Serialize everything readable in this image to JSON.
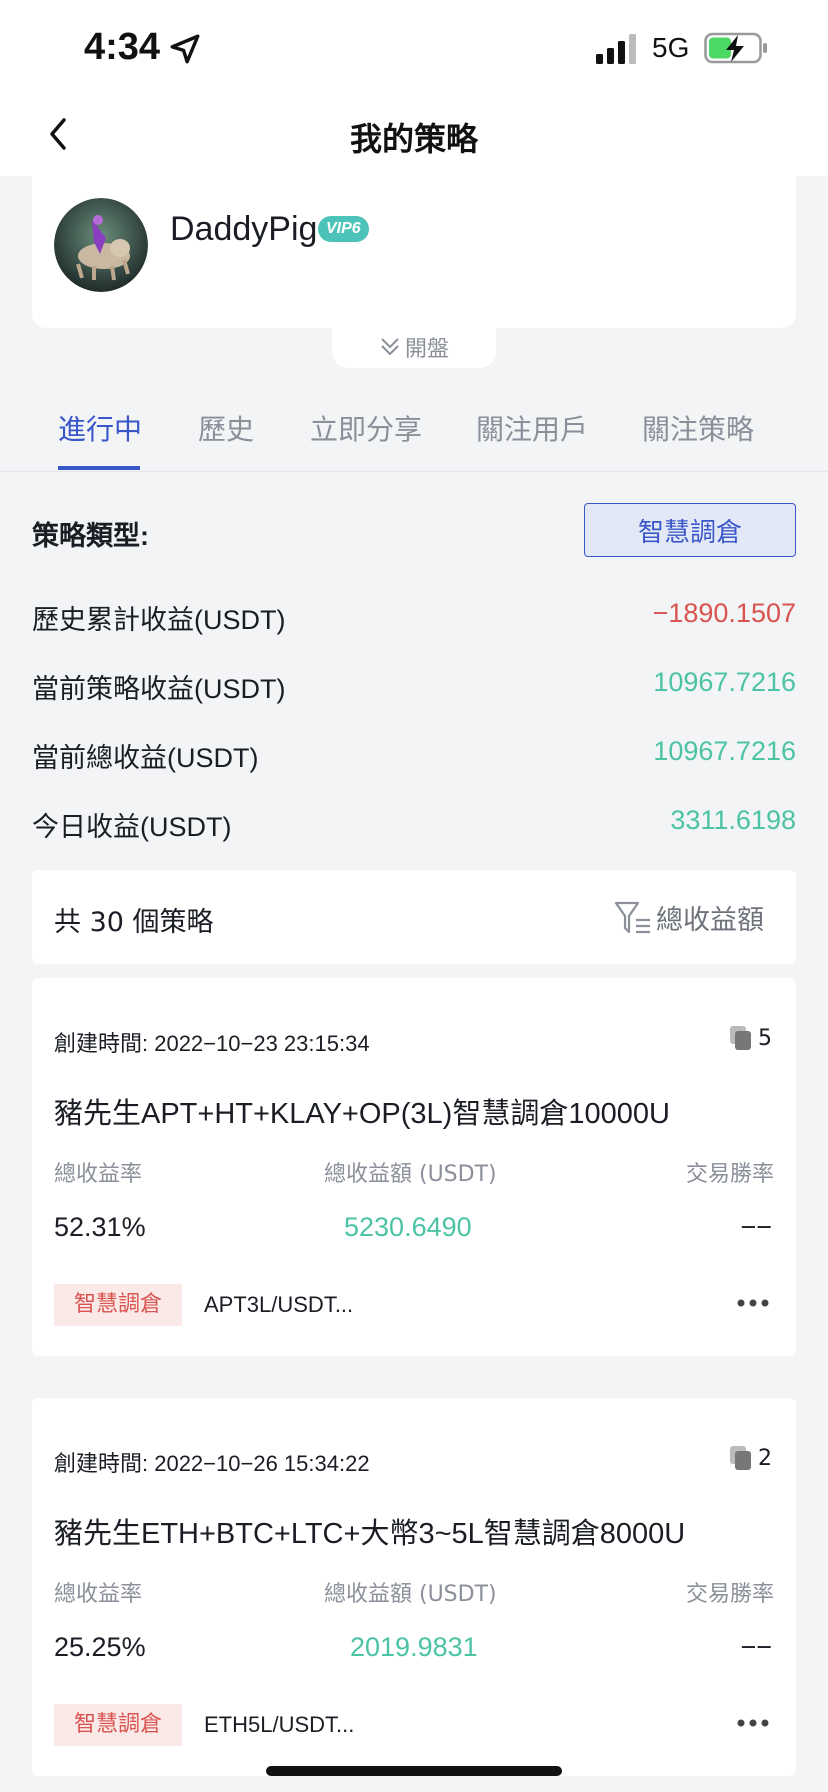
{
  "status": {
    "time": "4:34",
    "network": "5G"
  },
  "nav": {
    "title": "我的策略"
  },
  "profile": {
    "username": "DaddyPig",
    "vip": "VIP6",
    "expand_label": "開盤"
  },
  "tabs": [
    {
      "label": "進行中",
      "active": true
    },
    {
      "label": "歷史"
    },
    {
      "label": "立即分享"
    },
    {
      "label": "關注用戶"
    },
    {
      "label": "關注策略"
    }
  ],
  "strategy_type": {
    "label": "策略類型:",
    "value": "智慧調倉"
  },
  "stats": [
    {
      "label": "歷史累計收益(USDT)",
      "value": "−1890.1507"
    },
    {
      "label": "當前策略收益(USDT)",
      "value": "10967.7216"
    },
    {
      "label": "當前總收益(USDT)",
      "value": "10967.7216"
    },
    {
      "label": "今日收益(USDT)",
      "value": "3311.6198"
    }
  ],
  "summary": {
    "count_text": "共 30 個策略",
    "sort_label": "總收益額"
  },
  "columns": {
    "rate": "總收益率",
    "amount": "總收益額 (USDT)",
    "win": "交易勝率"
  },
  "strategies": [
    {
      "created": "創建時間: 2022−10−23 23:15:34",
      "copies": "5",
      "title": "豬先生APT+HT+KLAY+OP(3L)智慧調倉10000U",
      "rate": "52.31%",
      "amount": "5230.6490",
      "win": "−−",
      "tag": "智慧調倉",
      "pair": "APT3L/USDT..."
    },
    {
      "created": "創建時間: 2022−10−26 15:34:22",
      "copies": "2",
      "title": "豬先生ETH+BTC+LTC+大幣3~5L智慧調倉8000U",
      "rate": "25.25%",
      "amount": "2019.9831",
      "win": "−−",
      "tag": "智慧調倉",
      "pair": "ETH5L/USDT..."
    }
  ],
  "colors": {
    "accent": "#3a57c9",
    "positive": "#4cc3a5",
    "negative": "#d9534f",
    "vip": "#4cc3b8"
  }
}
